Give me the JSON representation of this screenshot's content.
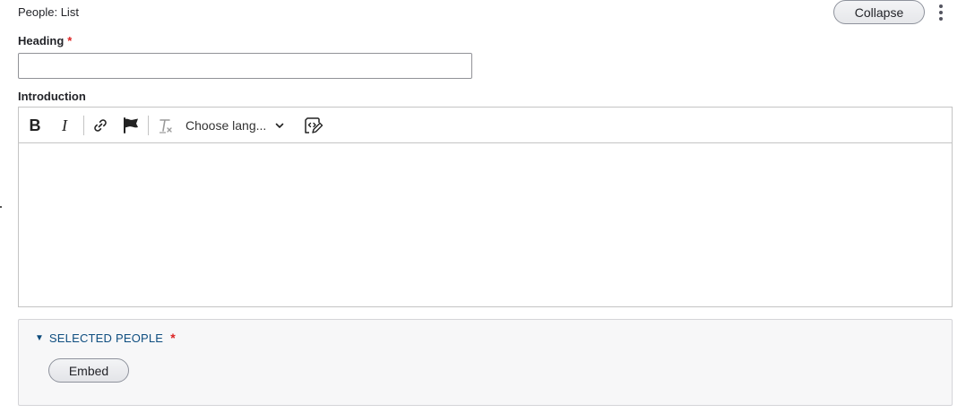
{
  "paragraph": {
    "type_label": "People: List",
    "collapse_label": "Collapse",
    "more_icon": "kebab-icon"
  },
  "heading_field": {
    "label": "Heading",
    "required_marker": "*",
    "value": ""
  },
  "introduction_field": {
    "label": "Introduction",
    "toolbar": {
      "bold_label": "B",
      "italic_label": "I",
      "link_icon": "link-icon",
      "flag_icon": "flag-icon",
      "remove_format_icon": "remove-format-icon",
      "language_select": "Choose lang...",
      "source_icon": "source-editing-icon"
    },
    "value": ""
  },
  "selected_people": {
    "summary": "SELECTED PEOPLE",
    "required_marker": "*",
    "embed_label": "Embed"
  },
  "colors": {
    "required": "#dc2323",
    "summary_link": "#0f4e80",
    "border": "#c4c4c4"
  }
}
